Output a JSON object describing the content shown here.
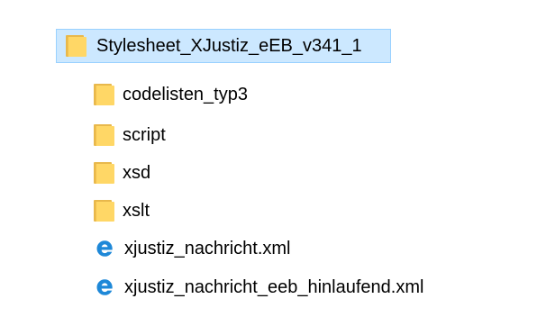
{
  "tree": {
    "root": {
      "name": "Stylesheet_XJustiz_eEB_v341_1",
      "icon": "folder-icon",
      "selected": true
    },
    "children": [
      {
        "name": "codelisten_typ3",
        "icon": "folder-icon"
      },
      {
        "name": "script",
        "icon": "folder-icon"
      },
      {
        "name": "xsd",
        "icon": "folder-icon"
      },
      {
        "name": "xslt",
        "icon": "folder-icon"
      },
      {
        "name": "xjustiz_nachricht.xml",
        "icon": "edge-browser-file-icon"
      },
      {
        "name": "xjustiz_nachricht_eeb_hinlaufend.xml",
        "icon": "edge-browser-file-icon"
      }
    ]
  },
  "colors": {
    "selection_background": "#cce8ff",
    "selection_border": "#99d1ff",
    "folder_front": "#ffd766",
    "folder_back": "#e8b84c",
    "browser_icon_blue": "#1e88d8"
  }
}
